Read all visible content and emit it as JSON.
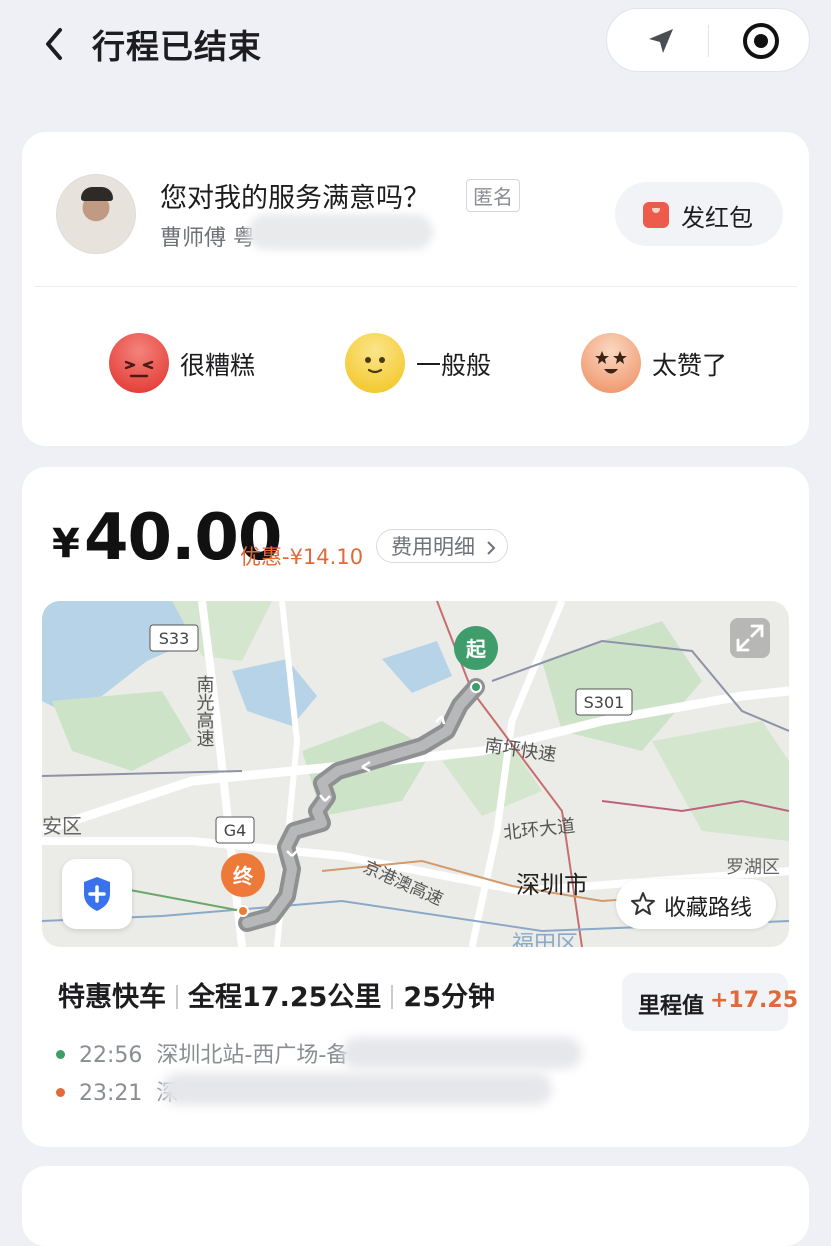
{
  "header": {
    "title": "行程已结束",
    "back_icon": "chevron-left-icon",
    "location_icon": "navigation-arrow-icon",
    "record_icon": "target-record-icon"
  },
  "rating_card": {
    "question": "您对我的服务满意吗？",
    "anonymous_label": "匿名",
    "driver_name": "曹师傅 粤",
    "red_packet_label": "发红包",
    "options": [
      {
        "label": "很糟糕",
        "icon": "angry-face-icon",
        "color": "#ea4d45"
      },
      {
        "label": "一般般",
        "icon": "neutral-face-icon",
        "color": "#f6cf3c"
      },
      {
        "label": "太赞了",
        "icon": "star-eyes-face-icon",
        "color": "#f2a67c"
      }
    ]
  },
  "fare_card": {
    "currency": "¥",
    "amount": "40.00",
    "discount": "优惠-¥14.10",
    "detail_button": "费用明细",
    "map": {
      "labels": {
        "s33": "S33",
        "s301": "S301",
        "g4": "G4",
        "nanguang": "南光高速",
        "nanping": "南坪快速",
        "beihuan": "北环大道",
        "jinggangao": "京港澳高速",
        "shenzhen": "深圳市",
        "luohu": "罗湖区",
        "baoan": "安区",
        "futian": "福田区"
      },
      "start_label": "起",
      "end_label": "终",
      "favorite_label": "收藏路线",
      "expand_icon": "expand-icon",
      "shield_icon": "safety-shield-icon"
    },
    "trip": {
      "type": "特惠快车",
      "distance": "全程17.25公里",
      "duration": "25分钟"
    },
    "mileage": {
      "label": "里程值",
      "value": "+17.25"
    },
    "stops": [
      {
        "time": "22:56",
        "place": "深圳北站-西广场-备",
        "color": "#3e9d6a"
      },
      {
        "time": "23:21",
        "place": "深",
        "color": "#e06a39"
      }
    ]
  },
  "colors": {
    "accent_orange": "#e06a39",
    "start_green": "#3e9d6a",
    "end_orange": "#ee7a3a"
  }
}
